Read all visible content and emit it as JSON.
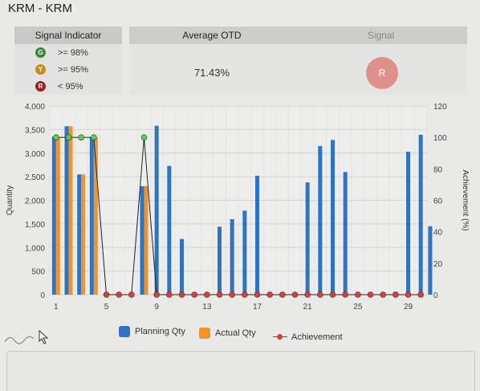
{
  "app": {
    "title": "KRM - KRM"
  },
  "indicator": {
    "header": "Signal Indicator",
    "rows": [
      {
        "letter": "G",
        "label": ">= 98%",
        "color": "#3a8a3a"
      },
      {
        "letter": "Y",
        "label": ">= 95%",
        "color": "#c88a1c"
      },
      {
        "letter": "R",
        "label": "< 95%",
        "color": "#9a2020"
      }
    ]
  },
  "otd": {
    "header": "Average OTD",
    "value": "71.43%"
  },
  "signal": {
    "header": "Signal",
    "value": "R",
    "color": "#e0908a"
  },
  "colors": {
    "planning": "#2f73c3",
    "actual": "#f0932b",
    "achievement_line": "#222222",
    "achievement_dot_low": "#e03b3b",
    "achievement_dot_high": "#55d24a"
  },
  "legend": {
    "planning": "Planning Qty",
    "actual": "Actual Qty",
    "achievement": "Achievement"
  },
  "chart_data": {
    "type": "bar",
    "ylabel": "Quantity",
    "y2label": "Achievement (%)",
    "ylim": [
      0,
      4000
    ],
    "y2lim": [
      0,
      120
    ],
    "y_ticks": [
      "0",
      "500",
      "1,000",
      "1,500",
      "2,000",
      "2,500",
      "3,000",
      "3,500",
      "4,000"
    ],
    "y2_ticks": [
      "0",
      "20",
      "40",
      "60",
      "80",
      "100",
      "120"
    ],
    "x_ticks": [
      "1",
      "5",
      "9",
      "13",
      "17",
      "21",
      "25",
      "29"
    ],
    "x": [
      1,
      2,
      3,
      4,
      5,
      6,
      7,
      8,
      9,
      10,
      11,
      12,
      13,
      14,
      15,
      16,
      17,
      18,
      19,
      20,
      21,
      22,
      23,
      24,
      25,
      26,
      27,
      28,
      29,
      30
    ],
    "series": [
      {
        "name": "Planning Qty",
        "type": "bar",
        "values": [
          3350,
          3570,
          2550,
          3330,
          0,
          0,
          0,
          2300,
          3580,
          2730,
          1180,
          0,
          0,
          1440,
          1600,
          1780,
          2520,
          0,
          0,
          0,
          2380,
          3150,
          3280,
          2600,
          0,
          0,
          0,
          60,
          3030,
          3390
        ]
      },
      {
        "name": "Actual Qty",
        "type": "bar",
        "values": [
          3330,
          3570,
          2550,
          3330,
          0,
          0,
          0,
          2300,
          0,
          0,
          0,
          0,
          0,
          0,
          0,
          0,
          0,
          0,
          0,
          0,
          0,
          0,
          0,
          0,
          0,
          0,
          0,
          0,
          0,
          0
        ]
      },
      {
        "name": "Achievement",
        "type": "line",
        "values": [
          100,
          100,
          100,
          100,
          0,
          0,
          0,
          100,
          0,
          0,
          0,
          0,
          0,
          0,
          0,
          0,
          0,
          0,
          0,
          0,
          0,
          0,
          0,
          0,
          0,
          0,
          0,
          0,
          0,
          0
        ]
      }
    ],
    "extra_planning_last": 1450,
    "grid": true,
    "legend_position": "bottom"
  }
}
